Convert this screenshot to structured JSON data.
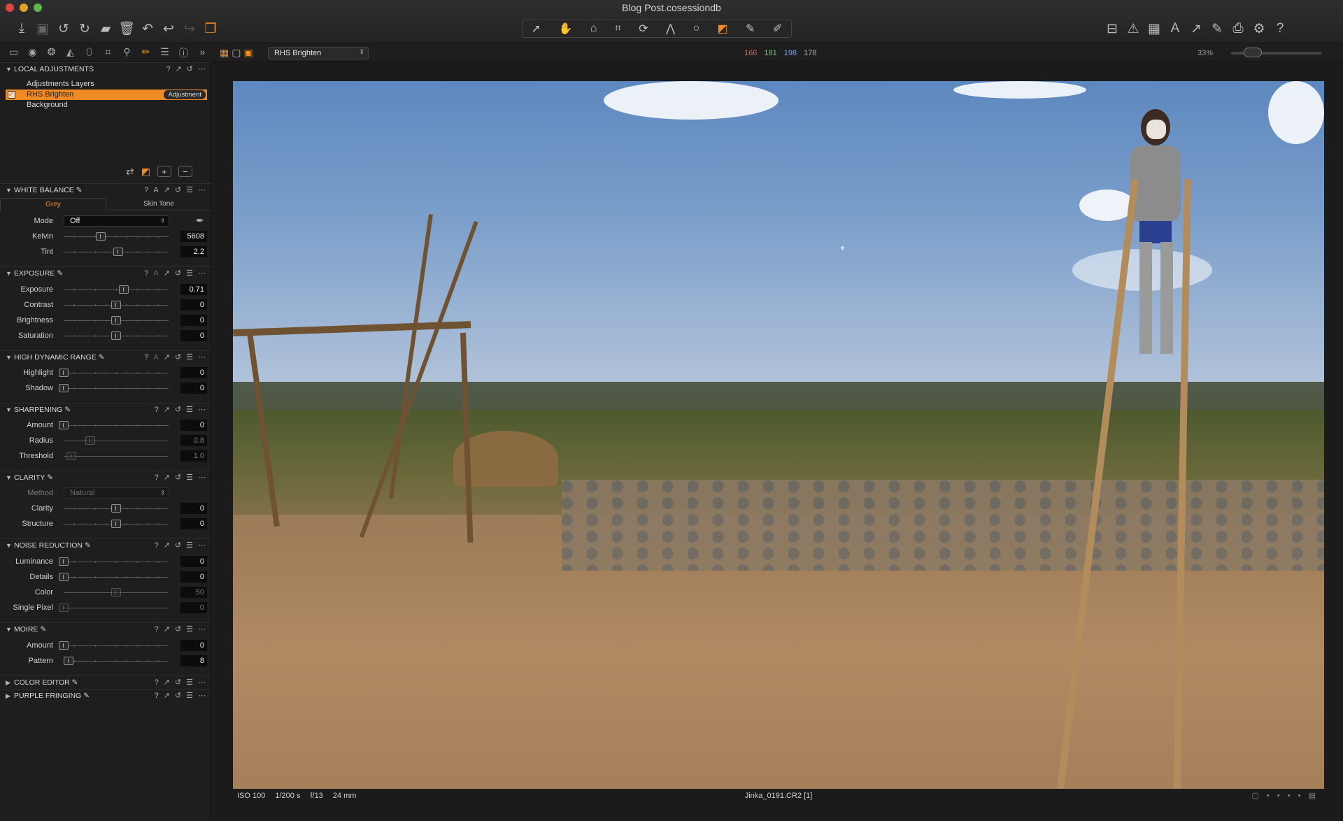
{
  "window": {
    "title": "Blog Post.cosessiondb"
  },
  "toolbar": {
    "left_icons": [
      "import-icon",
      "camera-icon",
      "rotate-left-icon",
      "rotate-right-icon",
      "folder-move-icon",
      "trash-icon",
      "undo-icon",
      "undo-arrow-icon",
      "redo-icon",
      "variants-icon"
    ],
    "cursor_tools": [
      "select-icon",
      "pan-icon",
      "loupe-icon",
      "crop-icon",
      "rotate-icon",
      "keystone-icon",
      "spot-icon",
      "brush-icon",
      "picker-icon",
      "annotate-icon"
    ],
    "right_icons": [
      "compare-icon",
      "exposure-warning-icon",
      "grid-icon",
      "text-icon",
      "edit-icon",
      "copy-icon",
      "print-icon",
      "settings-icon",
      "help-icon"
    ]
  },
  "secondary_bar": {
    "layer_select": "RHS Brighten",
    "rgb": {
      "r": "166",
      "g": "181",
      "b": "198",
      "l": "178"
    },
    "zoom": "33%",
    "colors": {
      "r": "#e46060",
      "g": "#6ccf6c",
      "b": "#7aa0ef",
      "l": "#aaaaaa"
    }
  },
  "local_adjustments": {
    "title": "LOCAL ADJUSTMENTS",
    "header_label": "Adjustments Layers",
    "layers": [
      {
        "name": "RHS Brighten",
        "tag": "Adjustment",
        "checked": true
      },
      {
        "name": "Background"
      }
    ]
  },
  "white_balance": {
    "title": "WHITE BALANCE",
    "tabs": [
      "Grey",
      "Skin Tone"
    ],
    "mode_label": "Mode",
    "mode_value": "Off",
    "kelvin_label": "Kelvin",
    "kelvin": "5608",
    "tint_label": "Tint",
    "tint": "2.2"
  },
  "exposure": {
    "title": "EXPOSURE",
    "rows": [
      {
        "label": "Exposure",
        "value": "0.71"
      },
      {
        "label": "Contrast",
        "value": "0"
      },
      {
        "label": "Brightness",
        "value": "0"
      },
      {
        "label": "Saturation",
        "value": "0"
      }
    ]
  },
  "hdr": {
    "title": "HIGH DYNAMIC RANGE",
    "rows": [
      {
        "label": "Highlight",
        "value": "0"
      },
      {
        "label": "Shadow",
        "value": "0"
      }
    ]
  },
  "sharpening": {
    "title": "SHARPENING",
    "rows": [
      {
        "label": "Amount",
        "value": "0"
      },
      {
        "label": "Radius",
        "value": "0.8"
      },
      {
        "label": "Threshold",
        "value": "1.0"
      }
    ]
  },
  "clarity": {
    "title": "CLARITY",
    "method_label": "Method",
    "method_value": "Natural",
    "rows": [
      {
        "label": "Clarity",
        "value": "0"
      },
      {
        "label": "Structure",
        "value": "0"
      }
    ]
  },
  "noise": {
    "title": "NOISE REDUCTION",
    "rows": [
      {
        "label": "Luminance",
        "value": "0"
      },
      {
        "label": "Details",
        "value": "0"
      },
      {
        "label": "Color",
        "value": "50"
      },
      {
        "label": "Single Pixel",
        "value": "0"
      }
    ]
  },
  "moire": {
    "title": "MOIRE",
    "rows": [
      {
        "label": "Amount",
        "value": "0"
      },
      {
        "label": "Pattern",
        "value": "8"
      }
    ]
  },
  "color_editor": {
    "title": "COLOR EDITOR"
  },
  "purple_fringing": {
    "title": "PURPLE FRINGING"
  },
  "status": {
    "iso": "ISO 100",
    "shutter": "1/200 s",
    "aperture": "f/13",
    "focal": "24 mm",
    "filename": "Jinka_0191.CR2 [1]"
  },
  "accent_color": "#f08a24"
}
